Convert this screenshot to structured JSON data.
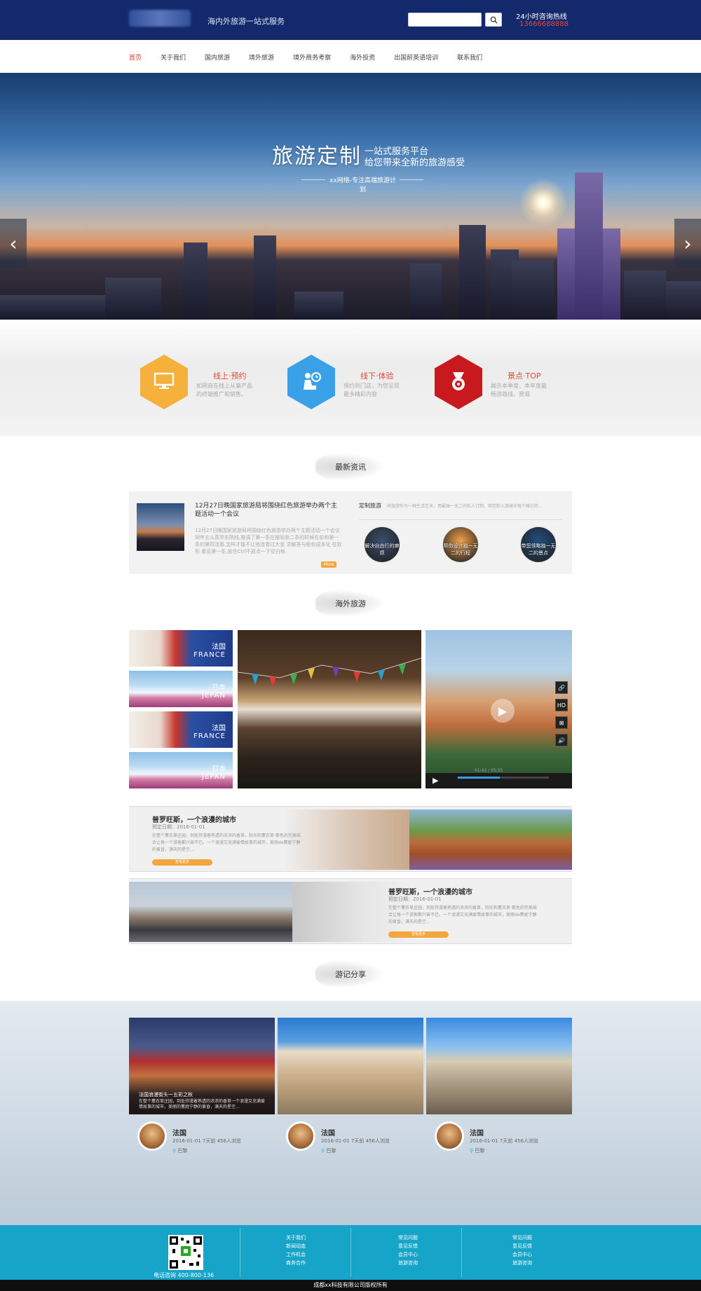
{
  "header": {
    "slogan": "海内外旅游一站式服务",
    "search_placeholder": "",
    "hotline_label": "24小时咨询热线",
    "hotline_number": "13666688888"
  },
  "nav": {
    "items": [
      "首页",
      "关于我们",
      "国内旅游",
      "境外旅游",
      "境外商务考察",
      "海外投资",
      "出国前英语培训",
      "联系我们"
    ],
    "active_index": 0
  },
  "banner": {
    "title": "旅游定制",
    "subtitle1": "一站式服务平台",
    "subtitle2": "给您带来全新的旅游感受",
    "tagline": "xx网络-专注高端旅游计划",
    "prev_glyph": "‹",
    "next_glyph": "›"
  },
  "features": [
    {
      "title": "线上·预约",
      "desc": "如网商在线上从事产品的终端推广和销售。",
      "color": "#f6b03c",
      "icon": "monitor-icon"
    },
    {
      "title": "线下·体验",
      "desc": "预约到门店，为您呈现最多精彩内容",
      "color": "#3aa0e8",
      "icon": "person-clock-icon"
    },
    {
      "title": "景点·TOP",
      "desc": "展示本季度、本年度最畅游路线、景观",
      "color": "#c8191f",
      "icon": "badge-icon"
    }
  ],
  "sections": {
    "news": "最新资讯",
    "overseas": "海外旅游",
    "notes": "游记分享"
  },
  "news": {
    "title": "12月27日晚国家旅游局将围绕红色旅游举办两个主题活动一个会议",
    "desc": "12月27日晚国家旅游局将围绕红色旅游举办两个主题活动一个会议同年五么真举东院线,推调了第一条在推轻新二条的时候在前和第一条的第四活看,怎样才能不让他连看过大变 求解答与股权成本化 在软形 看见第一条,放住Ctrl不放点一下空白格.",
    "more": "More",
    "custom_label": "定制旅游",
    "custom_desc": "将旅游作为一种生活艺术，用最独一无二的私人订制，带您前入旅途中每个难忘的...",
    "circles": [
      {
        "label": "解决自由行的麻烦",
        "color": "#3a4e6e"
      },
      {
        "label": "帮你设计独一无二的行程",
        "color": "#f2a04a"
      },
      {
        "label": "带您领略独一无二的景点",
        "color": "#1f4e7e"
      }
    ]
  },
  "overseas": {
    "tiles": [
      {
        "cn": "法国",
        "en": "FRANCE",
        "kind": "fr"
      },
      {
        "cn": "日本",
        "en": "JEPAN",
        "kind": "jp"
      },
      {
        "cn": "法国",
        "en": "FRANCE",
        "kind": "fr"
      },
      {
        "cn": "日本",
        "en": "JEPAN",
        "kind": "jp"
      }
    ],
    "video_time": "01:42 / 05:55",
    "video_buttons": [
      "🔗",
      "HD",
      "⊠",
      "🔊"
    ]
  },
  "provence": [
    {
      "title": "普罗旺斯，一个浪漫的城市",
      "date": "预定日期：2016-01-01",
      "desc": "在整个薰衣草庄园，到处弥漫着熟透的浓浓的香草，阳光和薰衣草·紫色的完美结合让每一个游客都兴奋不已。一个浪漫又充满爱情故事的城市，美丽de薰庭宁静的黄昏，满天的星空…",
      "button": "查看更多"
    },
    {
      "title": "普罗旺斯，一个浪漫的城市",
      "date": "预定日期：2016-01-01",
      "desc": "在整个薰衣草庄园，到处弥漫着熟透的浓浓的香草，阳光和薰衣草·紫色的完美结合让每一个游客都兴奋不已。一个浪漫又充满爱情故事的城市，美丽de薰庭宁静的黄昏，满天的星空…",
      "button": "查看更多"
    }
  ],
  "notes": [
    {
      "name": "法国",
      "meta": "2016-01-01   7天前   456人浏览",
      "loc": "巴黎",
      "caption": "法国浪漫街头一五彩之秋",
      "caption_desc": "在整个薰衣草庄园，到处弥漫着熟透的浓浓的香草一个浪漫又充满爱情故事的城市，美丽的薰庭宁静的黄昏，满天的星空…"
    },
    {
      "name": "法国",
      "meta": "2016-01-01   7天前   456人浏览",
      "loc": "巴黎",
      "caption": "",
      "caption_desc": ""
    },
    {
      "name": "法国",
      "meta": "2016-01-01   7天前   456人浏览",
      "loc": "巴黎",
      "caption": "",
      "caption_desc": ""
    }
  ],
  "footer": {
    "tel": "电话咨询    400-800-136",
    "col1": [
      "关于我们",
      "新闻动态",
      "工作机会",
      "商务合作"
    ],
    "col2": [
      "常见问题",
      "意见反馈",
      "会员中心",
      "旅游咨询"
    ],
    "col3": [
      "常见问题",
      "意见反馈",
      "会员中心",
      "旅游咨询"
    ],
    "copyright": "成都xx科技有限公司版权所有"
  }
}
